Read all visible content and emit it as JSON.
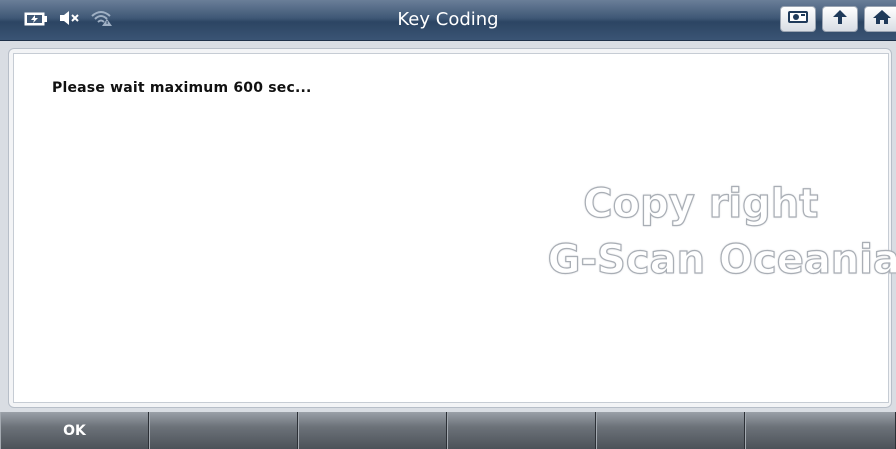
{
  "header": {
    "title": "Key Coding",
    "status_icons": [
      "battery-charging-icon",
      "speaker-muted-icon",
      "wifi-warning-icon"
    ],
    "buttons": [
      {
        "name": "capture-button",
        "icon": "camera-icon"
      },
      {
        "name": "back-button",
        "icon": "arrow-up-back-icon"
      },
      {
        "name": "home-button",
        "icon": "home-icon"
      }
    ]
  },
  "main": {
    "message": "Please wait maximum 600 sec..."
  },
  "watermark": {
    "line1": "Copy right",
    "line2": "G-Scan Oceania"
  },
  "softkeys": [
    "OK",
    "",
    "",
    "",
    "",
    ""
  ],
  "colors": {
    "titlebar": "#3f5876",
    "panel_bg": "#ffffff",
    "softkey_bg": "#6c7279"
  }
}
